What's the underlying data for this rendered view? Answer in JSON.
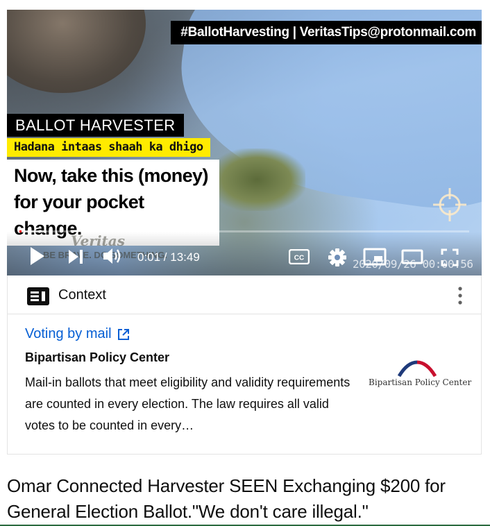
{
  "player": {
    "overlay_hashtag": "#BallotHarvesting | VeritasTips@protonmail.com",
    "lower_third_label": "BALLOT HARVESTER",
    "subtitle_somali": "Hadana intaas shaah ka dhigo",
    "subtitle_english": "Now, take this (money) for your pocket change.",
    "watermark_logo": "Veritas",
    "watermark_slogan": "BE BRAVE. DO SOMETHING.",
    "camera_timestamp": "2020/09/26  00:00:56",
    "time_display": "0:01 / 13:49",
    "progress_played_fraction": 0.002,
    "progress_loaded_fraction": 0.06,
    "progress_color": "#ff0000",
    "icons": {
      "play": "play-icon",
      "next": "next-icon",
      "volume": "volume-icon",
      "cc": "closed-captions-icon",
      "settings": "gear-icon",
      "miniplayer": "miniplayer-icon",
      "theater": "theater-mode-icon",
      "fullscreen": "fullscreen-icon"
    },
    "cc_label": "CC"
  },
  "context": {
    "title": "Context",
    "topic_link": "Voting by mail",
    "source": "Bipartisan Policy Center",
    "snippet": "Mail-in ballots that meet eligibility and validity requirements are counted in every election. The law requires all valid votes to be counted in every…",
    "logo_text": "Bipartisan Policy Center",
    "link_color": "#065fd4",
    "logo_arc_colors": [
      "#1f3a7a",
      "#c8102e"
    ]
  },
  "video": {
    "title": "Omar Connected Harvester SEEN Exchanging $200 for General Election Ballot.\"We don't care illegal.\""
  }
}
